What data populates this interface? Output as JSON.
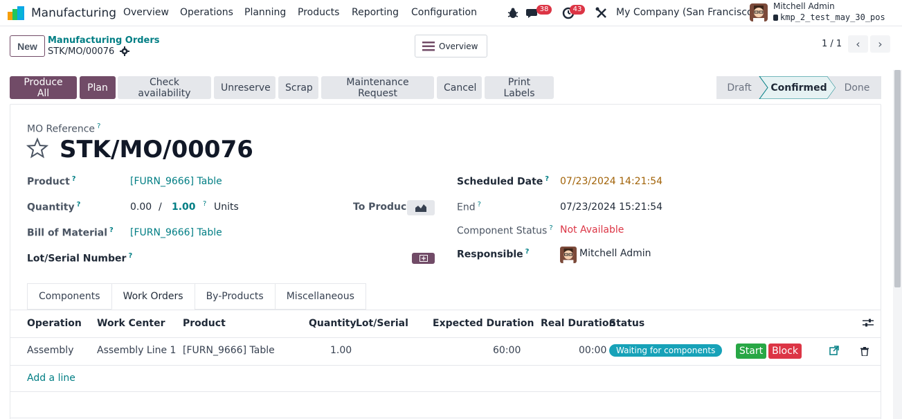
{
  "navbar": {
    "app_name": "Manufacturing",
    "menus": [
      "Overview",
      "Operations",
      "Planning",
      "Products",
      "Reporting",
      "Configuration"
    ],
    "messages_count": "38",
    "activities_count": "43",
    "company": "My Company (San Francisco)",
    "user_name": "Mitchell Admin",
    "db_name": "kmp_2_test_may_30_pos"
  },
  "control": {
    "new_label": "New",
    "breadcrumb_parent": "Manufacturing Orders",
    "breadcrumb_current": "STK/MO/00076",
    "overview_label": "Overview",
    "pager": "1 / 1"
  },
  "statusbar": {
    "buttons": [
      "Produce All",
      "Plan",
      "Check availability",
      "Unreserve",
      "Scrap",
      "Maintenance Request",
      "Cancel",
      "Print Labels"
    ],
    "stages": [
      "Draft",
      "Confirmed",
      "Done"
    ],
    "active_stage": "Confirmed"
  },
  "form": {
    "ref_label": "MO Reference",
    "ref": "STK/MO/00076",
    "product_label": "Product",
    "product": "[FURN_9666] Table",
    "quantity_label": "Quantity",
    "qty_done": "0.00",
    "qty_sep": "/",
    "qty_total": "1.00",
    "uom": "Units",
    "to_produce_label": "To Produce",
    "bom_label": "Bill of Material",
    "bom": "[FURN_9666] Table",
    "lot_label": "Lot/Serial Number",
    "scheduled_label": "Scheduled Date",
    "scheduled": "07/23/2024 14:21:54",
    "end_label": "End",
    "end": "07/23/2024 15:21:54",
    "component_status_label": "Component Status",
    "component_status": "Not Available",
    "responsible_label": "Responsible",
    "responsible": "Mitchell Admin",
    "help_mark": "?"
  },
  "tabs": [
    "Components",
    "Work Orders",
    "By-Products",
    "Miscellaneous"
  ],
  "active_tab": "Work Orders",
  "table": {
    "headers": {
      "operation": "Operation",
      "work_center": "Work Center",
      "product": "Product",
      "quantity": "Quantity",
      "lot": "Lot/Serial",
      "expected": "Expected Duration",
      "real": "Real Duration",
      "status": "Status"
    },
    "rows": [
      {
        "operation": "Assembly",
        "work_center": "Assembly Line 1",
        "product": "[FURN_9666] Table",
        "quantity": "1.00",
        "expected": "60:00",
        "real": "00:00",
        "status": "Waiting for components",
        "start_label": "Start",
        "block_label": "Block"
      }
    ],
    "add_line": "Add a line"
  },
  "colors": {
    "primary": "#714b67",
    "link": "#017e84",
    "danger": "#dc3545",
    "success": "#28a745",
    "info": "#17a2b8",
    "scheduled": "#a16207"
  }
}
